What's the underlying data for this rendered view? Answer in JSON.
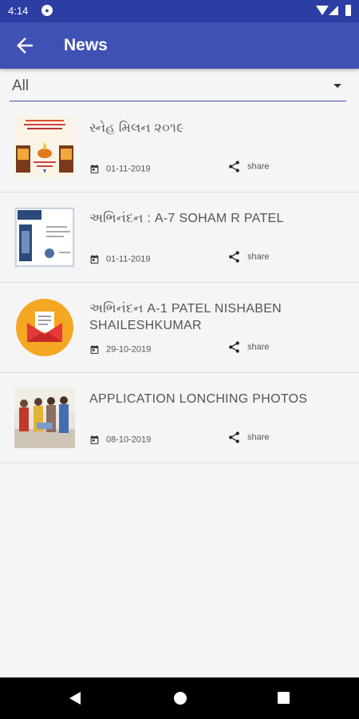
{
  "status_bar": {
    "time": "4:14",
    "notification_icon": "app-notification-icon"
  },
  "app_bar": {
    "title": "News",
    "back_icon": "arrow-back-icon"
  },
  "filter": {
    "selected": "All"
  },
  "news": [
    {
      "title": "સ્નેહ મિલન ૨૦૧૯",
      "date": "01-11-2019",
      "share_label": "share"
    },
    {
      "title": "અભિનંદન : A-7 SOHAM R PATEL",
      "date": "01-11-2019",
      "share_label": "share"
    },
    {
      "title": "અભિનંદન A-1  PATEL NISHABEN SHAILESHKUMAR",
      "date": "29-10-2019",
      "share_label": "share"
    },
    {
      "title": "APPLICATION LONCHING PHOTOS",
      "date": "08-10-2019",
      "share_label": "share"
    }
  ],
  "colors": {
    "status_bar": "#2c3ea3",
    "app_bar": "#3f51b5",
    "background": "#f5f5f5",
    "envelope_circle": "#f5a623"
  }
}
